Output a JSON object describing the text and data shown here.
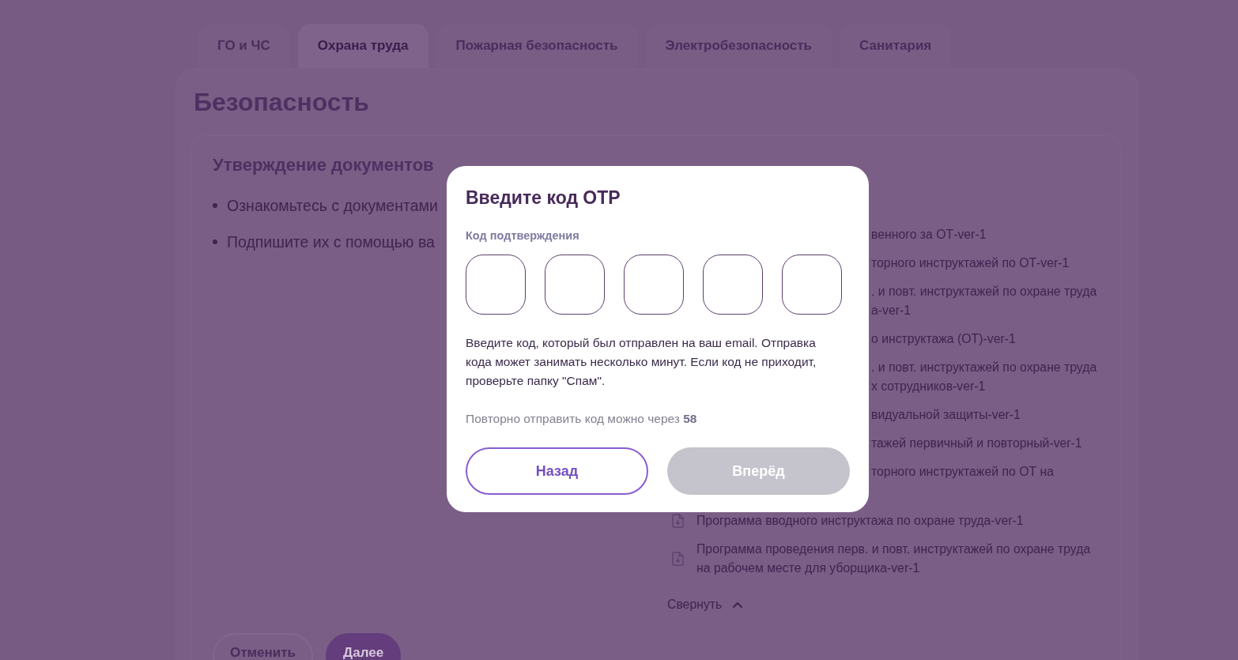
{
  "tabs": [
    {
      "label": "ГО и ЧС",
      "selected": false
    },
    {
      "label": "Охрана труда",
      "selected": true
    },
    {
      "label": "Пожарная безопасность",
      "selected": false
    },
    {
      "label": "Электробезопасность",
      "selected": false
    },
    {
      "label": "Санитария",
      "selected": false
    }
  ],
  "page": {
    "title": "Безопасность"
  },
  "approval_card": {
    "heading": "Утверждение документов",
    "steps": [
      "Ознакомьтесь с документами",
      "Подпишите их с помощью ва"
    ],
    "documents": [
      {
        "kind": "clipped",
        "lines": [
          "венного за ОТ-ver-1"
        ]
      },
      {
        "kind": "clipped",
        "lines": [
          "торного инструктажей по ОТ-ver-1"
        ]
      },
      {
        "kind": "clipped",
        "lines": [
          ". и повт. инструктажей по охране труда",
          "а-ver-1"
        ]
      },
      {
        "kind": "clipped",
        "lines": [
          "о инструктажа (ОТ)-ver-1"
        ]
      },
      {
        "kind": "clipped",
        "lines": [
          ". и повт. инструктажей по охране труда",
          "х сотрудников-ver-1"
        ]
      },
      {
        "kind": "clipped",
        "lines": [
          "видуальной защиты-ver-1"
        ]
      },
      {
        "kind": "clipped",
        "lines": [
          "тажей первичный и повторный-ver-1"
        ]
      },
      {
        "kind": "clipped",
        "lines": [
          "торного инструктажей по ОТ на"
        ]
      },
      {
        "kind": "file",
        "lines": [
          "Программа вводного инструктажа по охране труда-ver-1"
        ]
      },
      {
        "kind": "file",
        "lines": [
          "Программа проведения перв. и повт. инструктажей по охране труда",
          "на рабочем месте для уборщика-ver-1"
        ]
      }
    ],
    "collapse_link": "Свернуть",
    "buttons": [
      {
        "label": "Отменить",
        "kind": "secondary"
      },
      {
        "label": "Далее",
        "kind": "primary"
      }
    ]
  },
  "otp_dialog": {
    "title": "Введите код OTP",
    "field_label": "Код подтверждения",
    "code_fields": [
      {
        "focused": false
      },
      {
        "focused": false
      },
      {
        "focused": false
      },
      {
        "focused": false
      },
      {
        "focused": false
      }
    ],
    "hint": "Введите код, который был отправлен на ваш email. Отправка кода может занимать несколько минут. Если код не приходит, проверьте папку \"Спам\".",
    "resend_note": "Повторно отправить код можно через **58**",
    "buttons": [
      {
        "label": "Назад",
        "kind": "secondary",
        "disabled": false
      },
      {
        "label": "Вперёд",
        "kind": "primary",
        "disabled": true
      }
    ]
  }
}
